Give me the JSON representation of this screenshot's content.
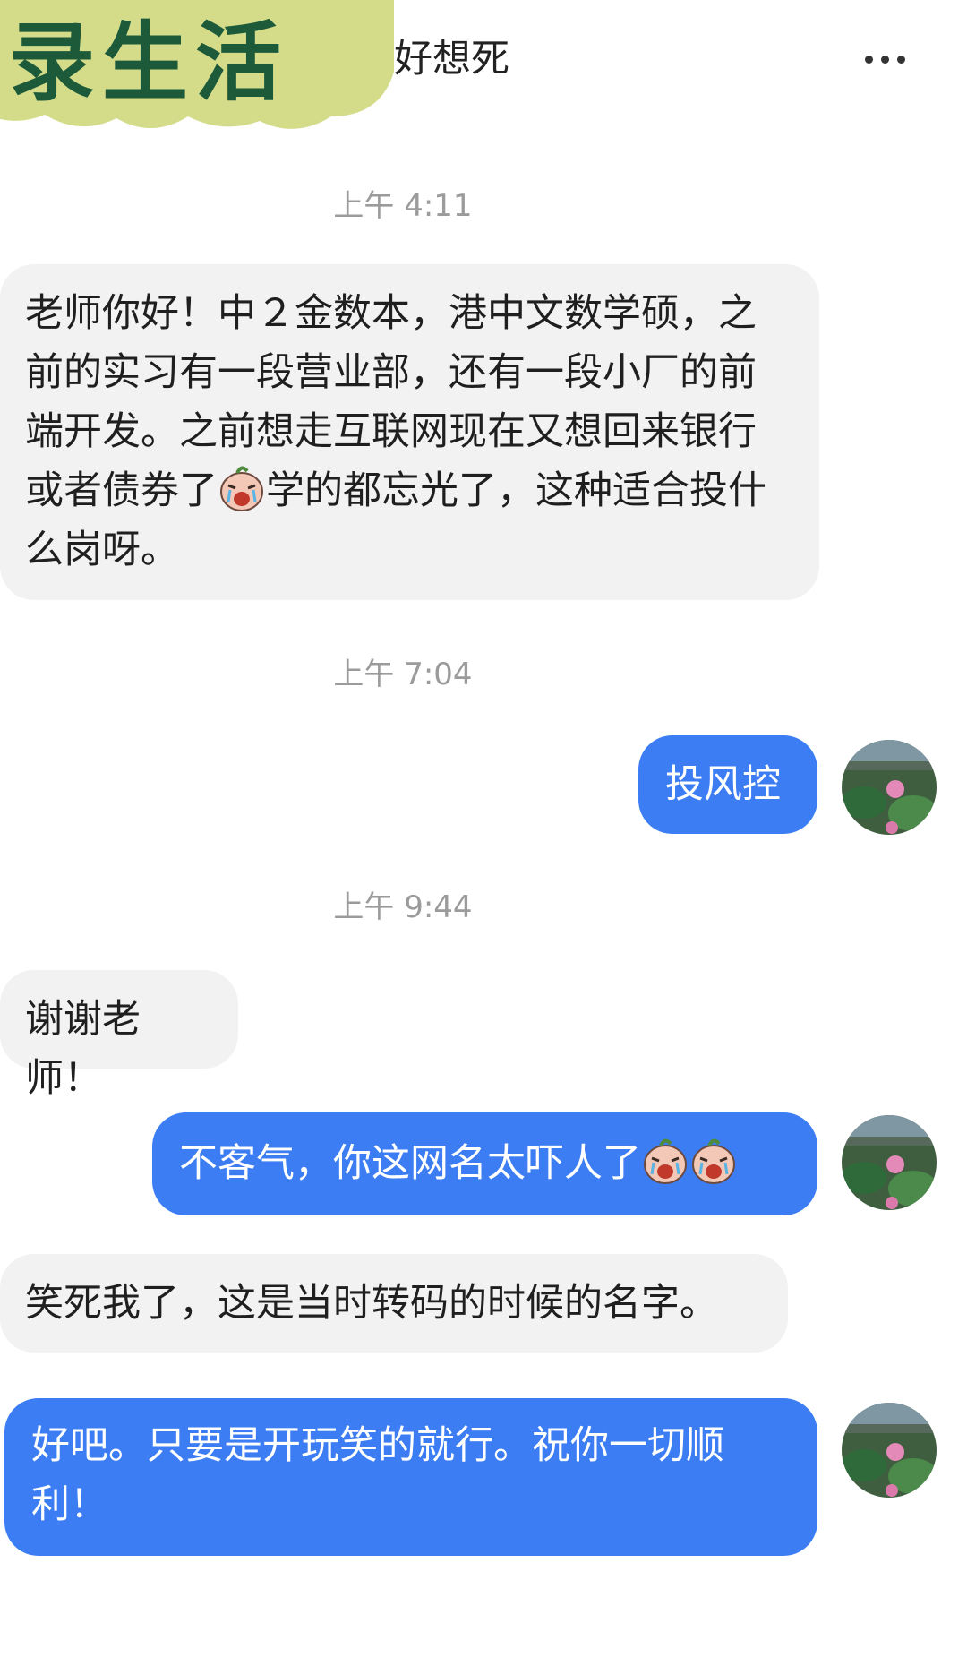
{
  "header": {
    "banner_text": "录生活",
    "contact_name": "好想死",
    "more_icon": "more-horizontal-icon"
  },
  "colors": {
    "banner_bg": "#d4dc8a",
    "banner_text": "#1d5a3a",
    "incoming_bubble": "#f2f2f2",
    "outgoing_bubble": "#3c7df3",
    "timestamp": "#9b9b9b"
  },
  "messages": [
    {
      "type": "timestamp",
      "text": "上午 4:11"
    },
    {
      "type": "incoming",
      "text_a": "老师你好！中２金数本，港中文数学硕，之前的实习有一段营业部，还有一段小厂的前端开发。之前想走互联网现在又想回来银行或者债券了",
      "emoji": "crying-face-icon",
      "text_b": "学的都忘光了，这种适合投什么岗呀。"
    },
    {
      "type": "timestamp",
      "text": "上午 7:04"
    },
    {
      "type": "outgoing",
      "text": "投风控"
    },
    {
      "type": "timestamp",
      "text": "上午 9:44"
    },
    {
      "type": "incoming",
      "text": "谢谢老师！"
    },
    {
      "type": "outgoing",
      "text": "不客气，你这网名太吓人了",
      "emojis": [
        "crying-face-icon",
        "crying-face-icon"
      ]
    },
    {
      "type": "incoming",
      "text": "笑死我了，这是当时转码的时候的名字。"
    },
    {
      "type": "outgoing",
      "text": "好吧。只要是开玩笑的就行。祝你一切顺利！"
    }
  ]
}
